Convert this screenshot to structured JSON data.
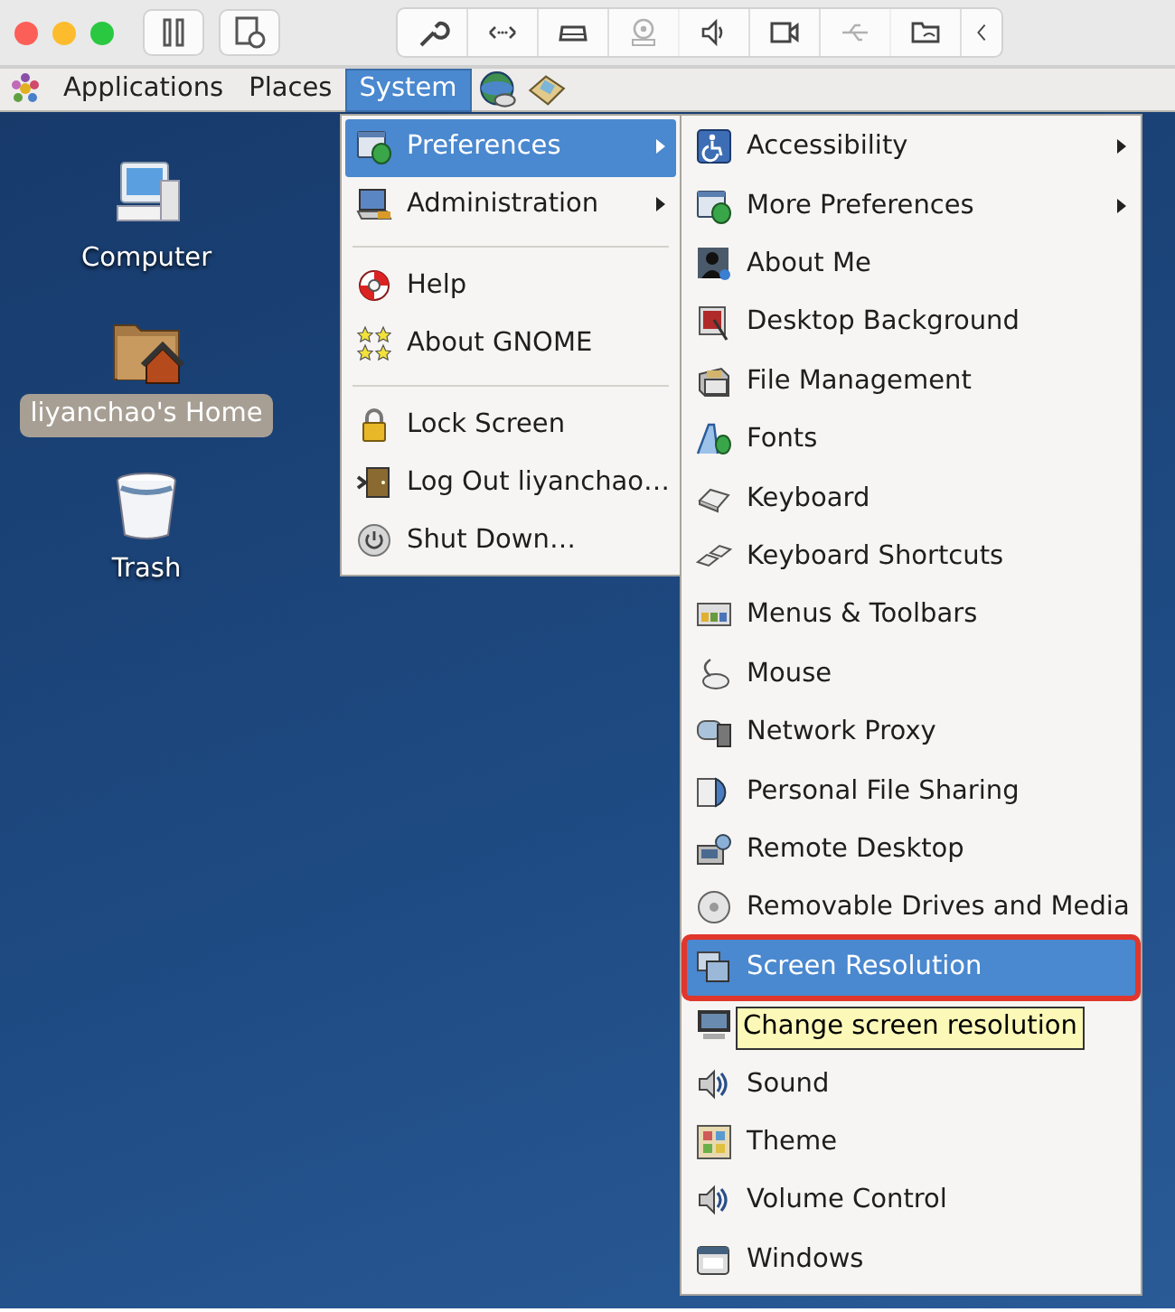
{
  "toolbar": {
    "left_buttons": [
      {
        "disabled": false
      },
      {
        "disabled": false
      }
    ],
    "device_buttons": [
      {
        "disabled": false
      },
      {
        "disabled": false
      },
      {
        "disabled": false
      },
      {
        "disabled": true
      },
      {
        "disabled": false
      },
      {
        "disabled": false
      },
      {
        "disabled": true
      },
      {
        "disabled": false
      },
      {
        "disabled": false
      }
    ]
  },
  "panel": {
    "menus": [
      {
        "label": "Applications",
        "selected": false
      },
      {
        "label": "Places",
        "selected": false
      },
      {
        "label": "System",
        "selected": true
      }
    ]
  },
  "desktop_icons": [
    {
      "label": "Computer",
      "selected": false
    },
    {
      "label": "liyanchao's Home",
      "selected": true
    },
    {
      "label": "Trash",
      "selected": false
    }
  ],
  "system_menu": [
    {
      "kind": "item",
      "label": "Preferences",
      "submenu": true,
      "selected": true
    },
    {
      "kind": "item",
      "label": "Administration",
      "submenu": true,
      "selected": false
    },
    {
      "kind": "separator"
    },
    {
      "kind": "item",
      "label": "Help",
      "submenu": false,
      "selected": false
    },
    {
      "kind": "item",
      "label": "About GNOME",
      "submenu": false,
      "selected": false
    },
    {
      "kind": "separator"
    },
    {
      "kind": "item",
      "label": "Lock Screen",
      "submenu": false,
      "selected": false
    },
    {
      "kind": "item",
      "label": "Log Out liyanchao…",
      "submenu": false,
      "selected": false
    },
    {
      "kind": "item",
      "label": "Shut Down…",
      "submenu": false,
      "selected": false
    }
  ],
  "preferences_menu": [
    {
      "label": "Accessibility",
      "submenu": true,
      "selected": false,
      "outlined": false
    },
    {
      "label": "More Preferences",
      "submenu": true,
      "selected": false,
      "outlined": false
    },
    {
      "label": "About Me",
      "submenu": false,
      "selected": false,
      "outlined": false
    },
    {
      "label": "Desktop Background",
      "submenu": false,
      "selected": false,
      "outlined": false
    },
    {
      "label": "File Management",
      "submenu": false,
      "selected": false,
      "outlined": false
    },
    {
      "label": "Fonts",
      "submenu": false,
      "selected": false,
      "outlined": false
    },
    {
      "label": "Keyboard",
      "submenu": false,
      "selected": false,
      "outlined": false
    },
    {
      "label": "Keyboard Shortcuts",
      "submenu": false,
      "selected": false,
      "outlined": false
    },
    {
      "label": "Menus & Toolbars",
      "submenu": false,
      "selected": false,
      "outlined": false
    },
    {
      "label": "Mouse",
      "submenu": false,
      "selected": false,
      "outlined": false
    },
    {
      "label": "Network Proxy",
      "submenu": false,
      "selected": false,
      "outlined": false
    },
    {
      "label": "Personal File Sharing",
      "submenu": false,
      "selected": false,
      "outlined": false
    },
    {
      "label": "Remote Desktop",
      "submenu": false,
      "selected": false,
      "outlined": false
    },
    {
      "label": "Removable Drives and Media",
      "submenu": false,
      "selected": false,
      "outlined": false
    },
    {
      "label": "Screen Resolution",
      "submenu": false,
      "selected": true,
      "outlined": true
    },
    {
      "submenu": false,
      "selected": false,
      "outlined": false
    },
    {
      "label": "Sound",
      "submenu": false,
      "selected": false,
      "outlined": false
    },
    {
      "label": "Theme",
      "submenu": false,
      "selected": false,
      "outlined": false
    },
    {
      "label": "Volume Control",
      "submenu": false,
      "selected": false,
      "outlined": false
    },
    {
      "label": "Windows",
      "submenu": false,
      "selected": false,
      "outlined": false
    }
  ],
  "tooltip": {
    "text": "Change screen resolution"
  }
}
